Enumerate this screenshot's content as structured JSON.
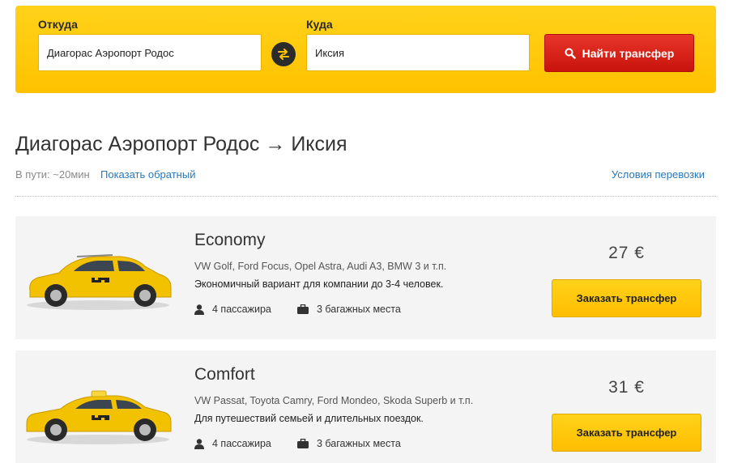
{
  "search": {
    "from_label": "Откуда",
    "from_value": "Диагорас Аэропорт Родос",
    "to_label": "Куда",
    "to_value": "Иксия",
    "find_button_label": "Найти трансфер"
  },
  "route": {
    "title": "Диагорас Аэропорт Родос → Иксия",
    "duration": "В пути: ~20мин",
    "reverse_link": "Показать обратный",
    "terms_link": "Условия перевозки"
  },
  "cards": [
    {
      "class_name": "Economy",
      "models": "VW Golf, Ford Focus, Opel Astra, Audi A3, BMW 3 и т.п.",
      "description": "Экономичный вариант для компании до 3-4 человек.",
      "passengers": "4 пассажира",
      "luggage": "3 багажных места",
      "price": "27  €",
      "order_label": "Заказать трансфер"
    },
    {
      "class_name": "Comfort",
      "models": "VW Passat, Toyota Camry, Ford Mondeo, Skoda Superb и т.п.",
      "description": "Для путешествий семьей и длительных поездок.",
      "passengers": "4 пассажира",
      "luggage": "3 багажных места",
      "price": "31  €",
      "order_label": "Заказать трансфер"
    }
  ],
  "colors": {
    "accent_yellow": "#ffc200",
    "button_red": "#d8200f",
    "link_blue": "#2a78b8"
  },
  "icons": [
    "swap-icon",
    "search-icon",
    "person-icon",
    "briefcase-icon",
    "taxi-hatchback-image",
    "taxi-sedan-image"
  ]
}
